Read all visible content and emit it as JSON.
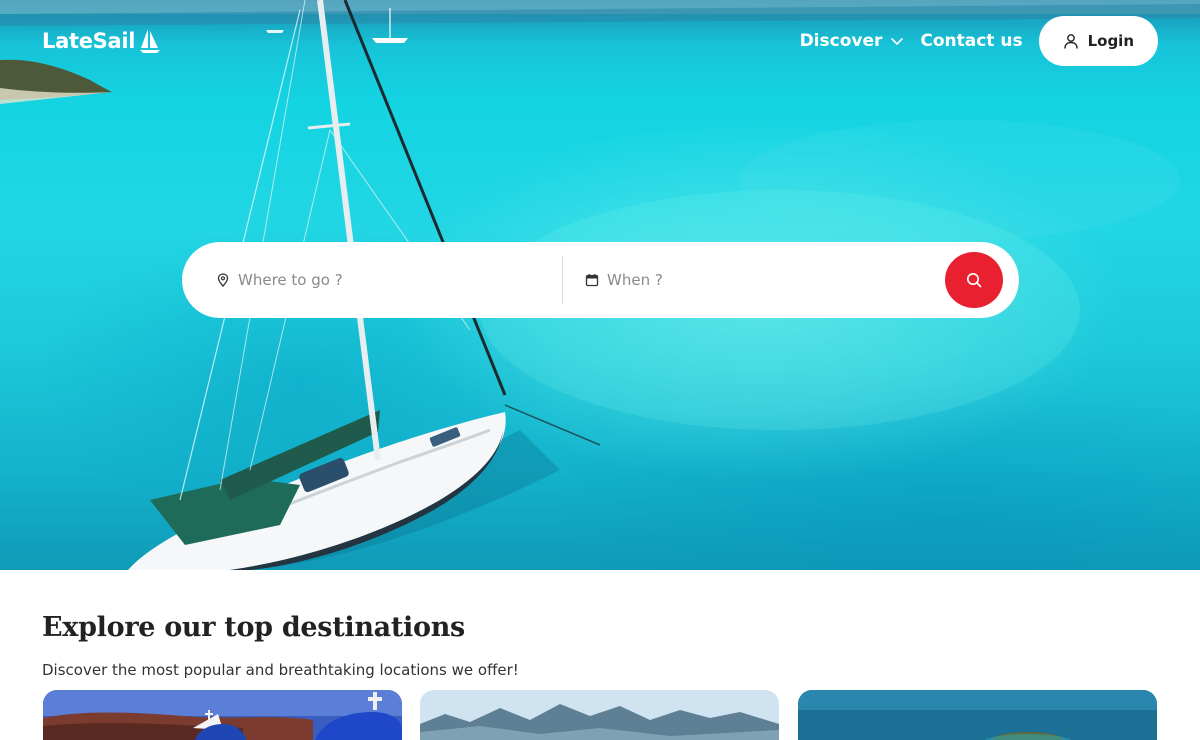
{
  "brand": {
    "name": "LateSail"
  },
  "nav": {
    "discover_label": "Discover",
    "contact_label": "Contact us",
    "login_label": "Login"
  },
  "search": {
    "where_placeholder": "Where to go ?",
    "when_placeholder": "When ?"
  },
  "destinations": {
    "title": "Explore our top destinations",
    "subtitle": "Discover the most popular and breathtaking locations we offer!"
  },
  "colors": {
    "accent": "#e8202f",
    "sea": "#18cfe0"
  },
  "icons": {
    "discover": "chevron-down-icon",
    "login": "user-icon",
    "where": "map-pin-icon",
    "when": "calendar-icon",
    "search": "search-icon"
  }
}
